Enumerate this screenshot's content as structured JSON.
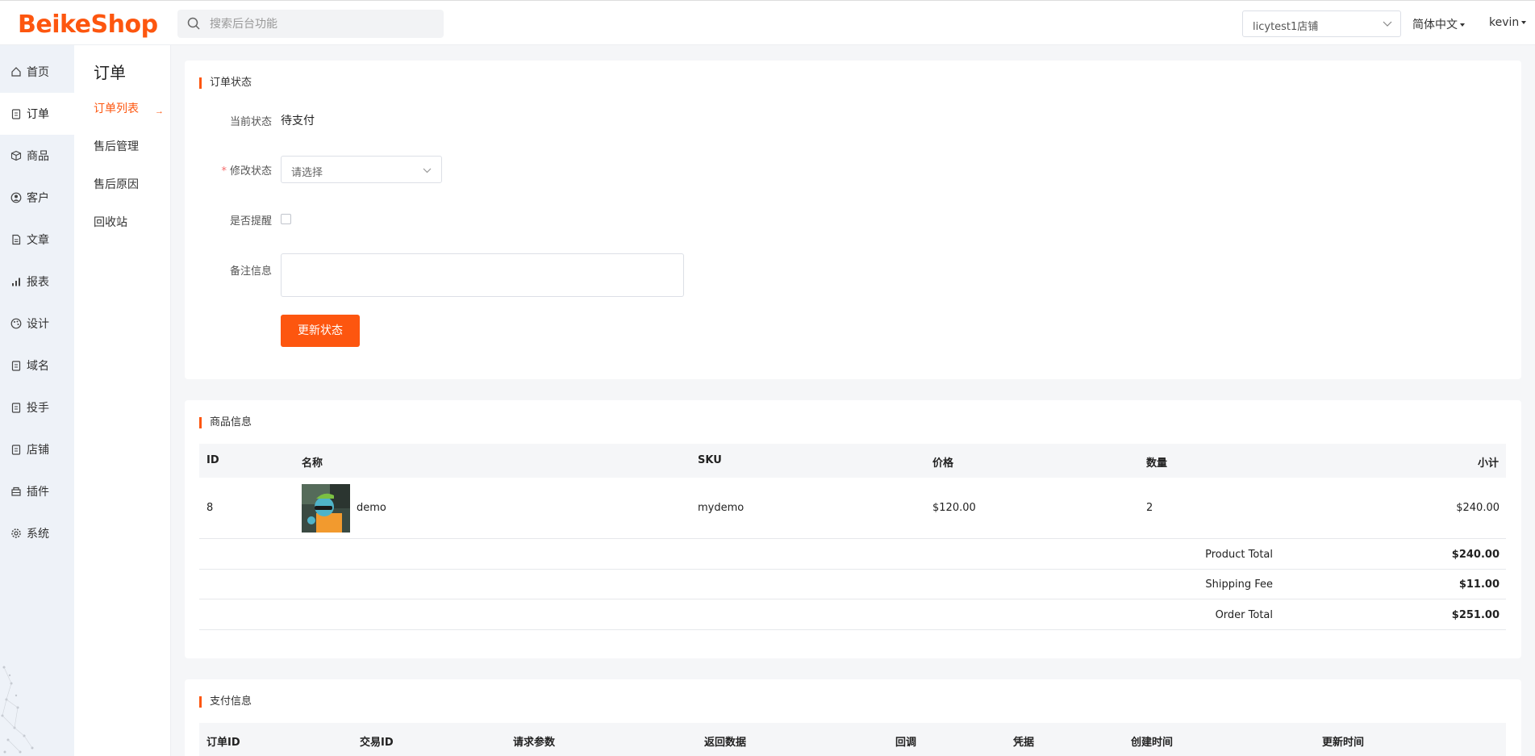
{
  "header": {
    "logo": "BeikeShop",
    "search_placeholder": "搜索后台功能",
    "store": "licytest1店铺",
    "language": "简体中文",
    "user": "kevin"
  },
  "leftnav": [
    {
      "label": "首页",
      "icon": "home-icon"
    },
    {
      "label": "订单",
      "icon": "clipboard-icon"
    },
    {
      "label": "商品",
      "icon": "box-icon"
    },
    {
      "label": "客户",
      "icon": "user-circle-icon"
    },
    {
      "label": "文章",
      "icon": "document-icon"
    },
    {
      "label": "报表",
      "icon": "bar-chart-icon"
    },
    {
      "label": "设计",
      "icon": "palette-icon"
    },
    {
      "label": "域名",
      "icon": "clipboard-icon"
    },
    {
      "label": "投手",
      "icon": "clipboard-icon"
    },
    {
      "label": "店铺",
      "icon": "clipboard-icon"
    },
    {
      "label": "插件",
      "icon": "plugin-icon"
    },
    {
      "label": "系统",
      "icon": "gear-icon"
    }
  ],
  "subnav": {
    "title": "订单",
    "items": [
      "订单列表",
      "售后管理",
      "售后原因",
      "回收站"
    ]
  },
  "order_status": {
    "title": "订单状态",
    "current_label": "当前状态",
    "current_value": "待支付",
    "modify_label": "修改状态",
    "modify_placeholder": "请选择",
    "notify_label": "是否提醒",
    "comment_label": "备注信息",
    "submit": "更新状态"
  },
  "products": {
    "title": "商品信息",
    "columns": [
      "ID",
      "名称",
      "SKU",
      "价格",
      "数量",
      "小计"
    ],
    "rows": [
      {
        "id": "8",
        "name": "demo",
        "sku": "mydemo",
        "price": "$120.00",
        "qty": "2",
        "subtotal": "$240.00"
      }
    ],
    "totals": [
      {
        "label": "Product Total",
        "value": "$240.00"
      },
      {
        "label": "Shipping Fee",
        "value": "$11.00"
      },
      {
        "label": "Order Total",
        "value": "$251.00"
      }
    ]
  },
  "payment": {
    "title": "支付信息",
    "columns": [
      "订单ID",
      "交易ID",
      "请求参数",
      "返回数据",
      "回调",
      "凭据",
      "创建时间",
      "更新时间"
    ]
  },
  "colors": {
    "accent": "#fd560f"
  }
}
